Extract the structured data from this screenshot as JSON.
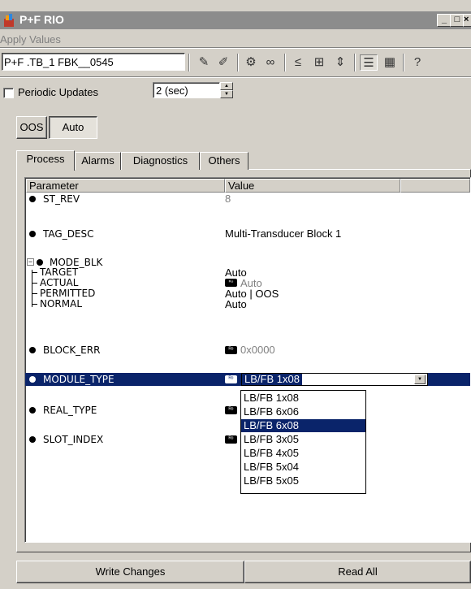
{
  "window": {
    "title": "P+F RIO",
    "min_glyph": "_",
    "max_glyph": "□",
    "close_glyph": "×"
  },
  "menu": {
    "apply_values": "Apply Values"
  },
  "toolbar": {
    "device_field": "P+F .TB_1     FBK__0545",
    "tools": [
      "✎",
      "✐",
      "⚙",
      "∞",
      "≤",
      "⊞",
      "⇕",
      "☰",
      "▦",
      "?"
    ]
  },
  "periodic": {
    "label": "Periodic Updates",
    "checked": false,
    "interval": "2 (sec)"
  },
  "mode_buttons": {
    "oos": "OOS",
    "auto": "Auto"
  },
  "tabs": [
    "Process",
    "Alarms",
    "Diagnostics",
    "Others"
  ],
  "active_tab": "Process",
  "grid": {
    "col_parameter": "Parameter",
    "col_value": "Value",
    "rows": {
      "st_rev": {
        "name": "ST_REV",
        "value": "8"
      },
      "tag_desc": {
        "name": "TAG_DESC",
        "value": "Multi-Transducer Block 1"
      },
      "mode_blk": {
        "name": "MODE_BLK",
        "children": [
          {
            "name": "TARGET",
            "value": "Auto"
          },
          {
            "name": "ACTUAL",
            "value": "Auto"
          },
          {
            "name": "PERMITTED",
            "value": "Auto | OOS"
          },
          {
            "name": "NORMAL",
            "value": "Auto"
          }
        ]
      },
      "block_err": {
        "name": "BLOCK_ERR",
        "value": "0x0000"
      },
      "module_type": {
        "name": "MODULE_TYPE",
        "value": "LB/FB 1x08"
      },
      "real_type": {
        "name": "REAL_TYPE"
      },
      "slot_index": {
        "name": "SLOT_INDEX"
      }
    },
    "lock_icon_text": "ᴿᵒ"
  },
  "dropdown": {
    "options": [
      "LB/FB 1x08",
      "LB/FB 6x06",
      "LB/FB 6x08",
      "LB/FB 3x05",
      "LB/FB 4x05",
      "LB/FB 5x04",
      "LB/FB 5x05"
    ],
    "highlighted": "LB/FB 6x08"
  },
  "bottom": {
    "write": "Write Changes",
    "read": "Read All"
  },
  "colors": {
    "selection": "#0a246a",
    "face": "#d4d0c8",
    "title": "#8c8c8c"
  }
}
